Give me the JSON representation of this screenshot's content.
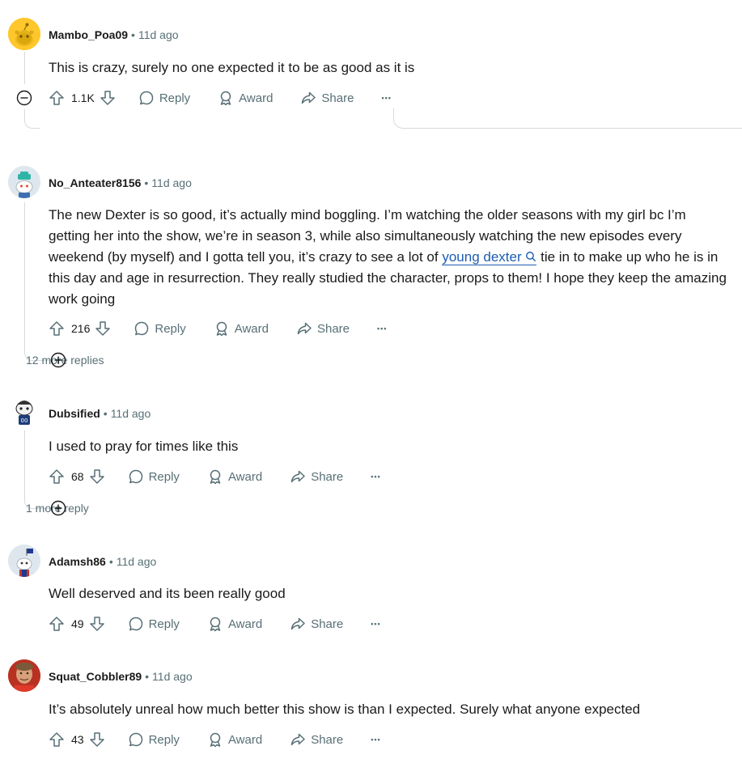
{
  "comments": [
    {
      "username": "Mambo_Poa09",
      "age": "11d ago",
      "text": "This is crazy, surely no one expected it to be as good as it is",
      "votes": "1.1K",
      "reply": "Reply",
      "award": "Award",
      "share": "Share",
      "avatar_color": "#ffc72c"
    },
    {
      "username": "No_Anteater8156",
      "age": "11d ago",
      "text_before": "The new Dexter is so good, it’s actually mind boggling. I’m watching the older seasons with my girl bc I’m getting her into the show, we’re in season 3, while also simultaneously watching the new episodes every weekend (by myself) and I gotta tell you, it’s crazy to see a lot of",
      "link_text": "young dexter",
      "text_after": "tie in to make up who he is in this day and age in resurrection. They really studied the character, props to them! I hope they keep the amazing work going",
      "votes": "216",
      "reply": "Reply",
      "award": "Award",
      "share": "Share",
      "more_replies": "12 more replies"
    },
    {
      "username": "Dubsified",
      "age": "11d ago",
      "text": "I used to pray for times like this",
      "votes": "68",
      "reply": "Reply",
      "award": "Award",
      "share": "Share",
      "more_replies": "1 more reply"
    },
    {
      "username": "Adamsh86",
      "age": "11d ago",
      "text": "Well deserved and its been really good",
      "votes": "49",
      "reply": "Reply",
      "award": "Award",
      "share": "Share"
    },
    {
      "username": "Squat_Cobbler89",
      "age": "11d ago",
      "text": "It’s absolutely unreal how much better this show is than I expected. Surely what anyone expected",
      "votes": "43",
      "reply": "Reply",
      "award": "Award",
      "share": "Share"
    }
  ],
  "separator": "•",
  "more_glyph": "•••"
}
